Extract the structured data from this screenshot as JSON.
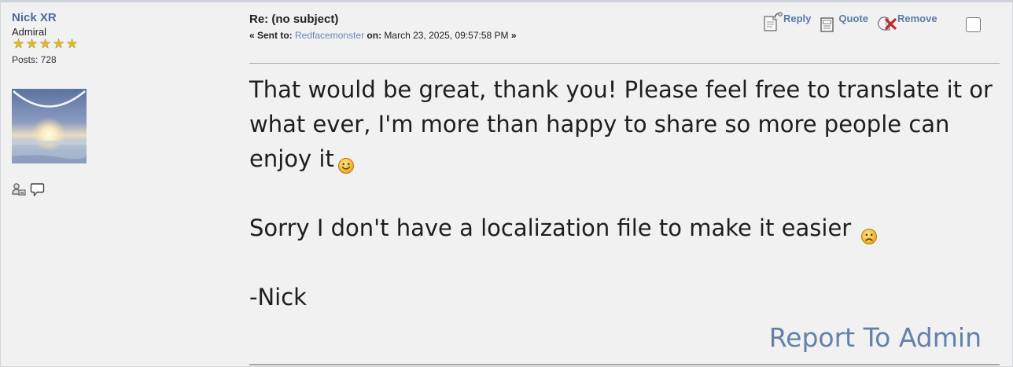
{
  "post": {
    "author": {
      "name": "Nick XR",
      "rank": "Admiral",
      "stars": 5,
      "posts_label": "Posts: 728",
      "avatar_icon": "sunset-avatar",
      "profile_icons": [
        "profile-icon",
        "message-icon"
      ]
    },
    "header": {
      "subject": "Re: (no subject)",
      "sent_prefix": "« Sent to:",
      "recipient": "Redfacemonster",
      "date_prefix": "on:",
      "date": "March 23, 2025, 09:57:58 PM",
      "sent_suffix": "»"
    },
    "actions": {
      "reply": "Reply",
      "quote": "Quote",
      "remove": "Remove"
    },
    "body": {
      "paragraph1": "That would be great, thank you! Please feel free to translate it or what ever, I'm more than happy to share so more people can enjoy it",
      "paragraph1_emoji": "smiley",
      "paragraph2": "Sorry I don't have a localization file to make it easier",
      "paragraph2_emoji": "sad",
      "signature": "-Nick"
    },
    "footer": {
      "report_label": "Report To Admin"
    }
  },
  "colors": {
    "link": "#6b86b4",
    "name": "#4f6b99",
    "report": "#6581a8",
    "star": "#e4be1e",
    "background": "#f1f1f1"
  }
}
